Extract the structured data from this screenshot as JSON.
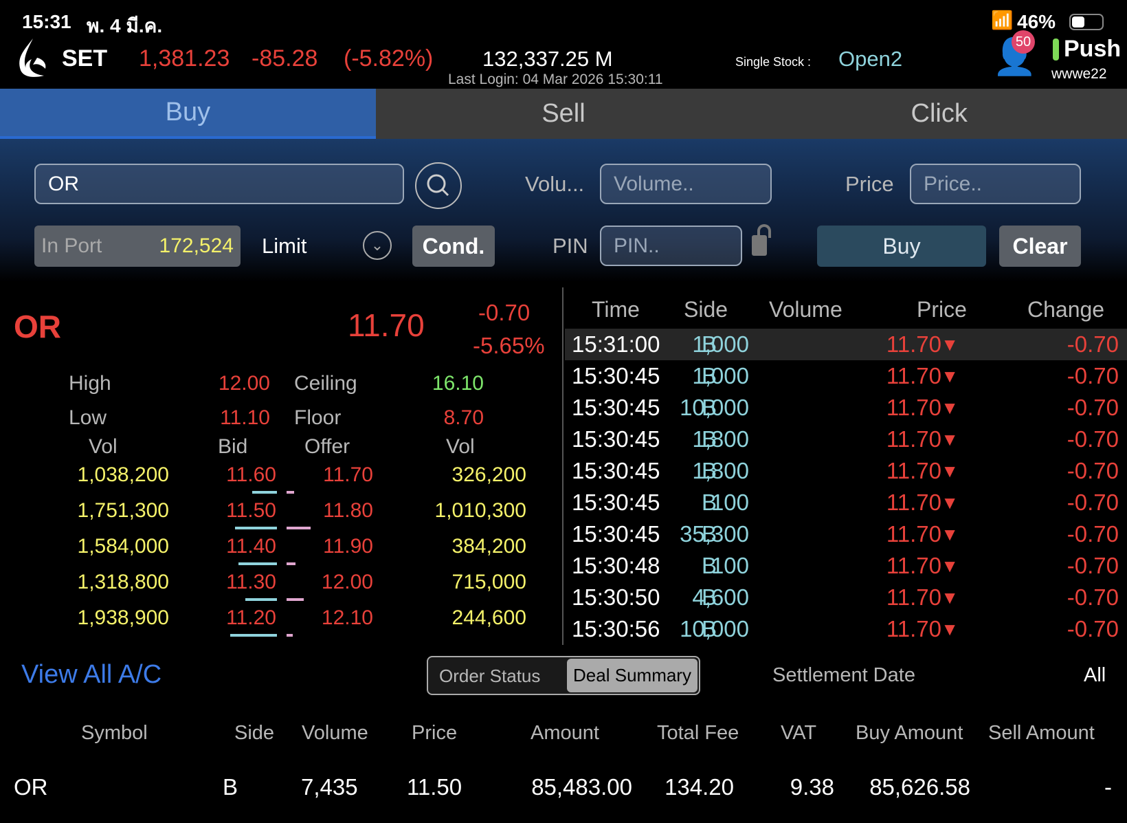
{
  "status": {
    "time": "15:31",
    "date": "พ. 4 มี.ค.",
    "battery": "46%"
  },
  "header": {
    "index_name": "SET",
    "index_value": "1,381.23",
    "change": "-85.28",
    "change_pct": "(-5.82%)",
    "value": "132,337.25 M",
    "last_login": "Last Login: 04 Mar 2026 15:30:11",
    "single_stock_label": "Single Stock :",
    "single_stock_value": "Open2",
    "badge": "50",
    "push": "Push",
    "user": "wwwe22"
  },
  "tabs": [
    {
      "label": "Buy",
      "active": true
    },
    {
      "label": "Sell"
    },
    {
      "label": "Click"
    }
  ],
  "form": {
    "symbol": "OR",
    "volume_label": "Volu...",
    "volume_placeholder": "Volume..",
    "price_label": "Price",
    "price_placeholder": "Price..",
    "inport_label": "In Port",
    "inport_value": "172,524",
    "order_type": "Limit",
    "cond": "Cond.",
    "pin_label": "PIN",
    "pin_placeholder": "PIN..",
    "buy": "Buy",
    "clear": "Clear"
  },
  "quote": {
    "symbol": "OR",
    "last": "11.70",
    "change": "-0.70",
    "change_pct": "-5.65%",
    "high_label": "High",
    "high": "12.00",
    "low_label": "Low",
    "low": "11.10",
    "ceiling_label": "Ceiling",
    "ceiling": "16.10",
    "floor_label": "Floor",
    "floor": "8.70"
  },
  "book": {
    "headers": [
      "Vol",
      "Bid",
      "Offer",
      "Vol"
    ],
    "rows": [
      {
        "bid_vol": "1,038,200",
        "bid": "11.60",
        "offer": "11.70",
        "offer_vol": "326,200",
        "bid_n": 1038200,
        "offer_n": 326200
      },
      {
        "bid_vol": "1,751,300",
        "bid": "11.50",
        "offer": "11.80",
        "offer_vol": "1,010,300",
        "bid_n": 1751300,
        "offer_n": 1010300
      },
      {
        "bid_vol": "1,584,000",
        "bid": "11.40",
        "offer": "11.90",
        "offer_vol": "384,200",
        "bid_n": 1584000,
        "offer_n": 384200
      },
      {
        "bid_vol": "1,318,800",
        "bid": "11.30",
        "offer": "12.00",
        "offer_vol": "715,000",
        "bid_n": 1318800,
        "offer_n": 715000
      },
      {
        "bid_vol": "1,938,900",
        "bid": "11.20",
        "offer": "12.10",
        "offer_vol": "244,600",
        "bid_n": 1938900,
        "offer_n": 244600
      }
    ]
  },
  "ticks": {
    "headers": [
      "Time",
      "Side",
      "Volume",
      "Price",
      "Change"
    ],
    "rows": [
      [
        "15:31:00",
        "B",
        "1,000",
        "11.70",
        "-0.70"
      ],
      [
        "15:30:45",
        "B",
        "1,000",
        "11.70",
        "-0.70"
      ],
      [
        "15:30:45",
        "B",
        "10,000",
        "11.70",
        "-0.70"
      ],
      [
        "15:30:45",
        "B",
        "1,800",
        "11.70",
        "-0.70"
      ],
      [
        "15:30:45",
        "B",
        "1,800",
        "11.70",
        "-0.70"
      ],
      [
        "15:30:45",
        "B",
        "100",
        "11.70",
        "-0.70"
      ],
      [
        "15:30:45",
        "B",
        "35,300",
        "11.70",
        "-0.70"
      ],
      [
        "15:30:48",
        "B",
        "100",
        "11.70",
        "-0.70"
      ],
      [
        "15:30:50",
        "B",
        "4,600",
        "11.70",
        "-0.70"
      ],
      [
        "15:30:56",
        "B",
        "10,000",
        "11.70",
        "-0.70"
      ]
    ]
  },
  "bottom": {
    "view_all": "View All A/C",
    "seg": [
      "Order Status",
      "Deal Summary"
    ],
    "seg_active": 1,
    "settlement": "Settlement Date",
    "all": "All",
    "headers": [
      "Symbol",
      "Side",
      "Volume",
      "Price",
      "Amount",
      "Total Fee",
      "VAT",
      "Buy Amount",
      "Sell Amount"
    ],
    "rows": [
      [
        "OR",
        "B",
        "7,435",
        "11.50",
        "85,483.00",
        "134.20",
        "9.38",
        "85,626.58",
        "-"
      ]
    ]
  },
  "colors": {
    "up": "#7ee66b",
    "down": "#e8413a",
    "volume": "#f5f26a",
    "accent": "#2f5fa6"
  }
}
